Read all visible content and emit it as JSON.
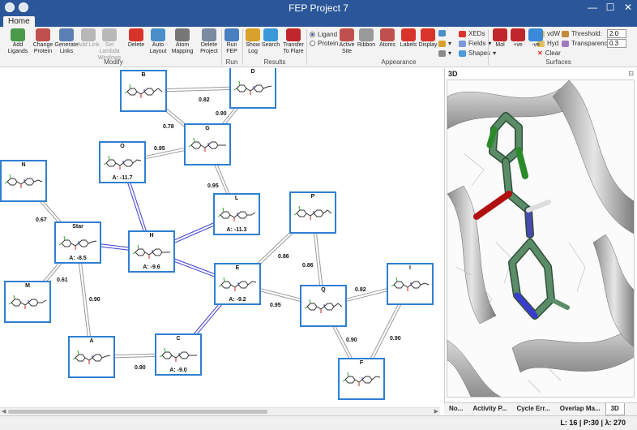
{
  "app": {
    "title": "FEP Project 7",
    "active_tab": "Home",
    "window_controls": [
      "—",
      "☐",
      "✕"
    ]
  },
  "ribbon": {
    "modify": {
      "group_label": "Modify",
      "buttons": [
        {
          "label": "Add Ligands",
          "icon": "add-ligands-icon",
          "color": "#4a9a4a"
        },
        {
          "label": "Change Protein",
          "icon": "change-protein-icon",
          "color": "#c0504d"
        },
        {
          "label": "Generate Links",
          "icon": "generate-links-icon",
          "color": "#5a7fb5"
        },
        {
          "label": "Add Link",
          "icon": "add-link-icon",
          "color": "#b8b8b8"
        },
        {
          "label": "Set Lambda Windows",
          "icon": "lambda-icon",
          "color": "#b8b8b8"
        },
        {
          "label": "Delete",
          "icon": "delete-icon",
          "color": "#d9342b"
        },
        {
          "label": "Auto Layout",
          "icon": "auto-layout-icon",
          "color": "#4a8fc9"
        },
        {
          "label": "Atom Mapping",
          "icon": "atom-mapping-icon",
          "color": "#777777"
        },
        {
          "label": "Delete Project",
          "icon": "delete-project-icon",
          "color": "#7a8aa0"
        }
      ]
    },
    "run": {
      "group_label": "Run",
      "buttons": [
        {
          "label": "Run FEP",
          "icon": "calculator-icon",
          "color": "#4a7fc1"
        }
      ]
    },
    "results": {
      "group_label": "Results",
      "buttons": [
        {
          "label": "Show Log",
          "icon": "log-icon",
          "color": "#d9a02b"
        },
        {
          "label": "Search",
          "icon": "search-icon",
          "color": "#3a9ad9"
        },
        {
          "label": "Transfer To Flare",
          "icon": "flare-icon",
          "color": "#c0272d"
        }
      ]
    },
    "view": {
      "radios": [
        {
          "label": "Ligand",
          "selected": true
        },
        {
          "label": "Protein",
          "selected": false
        }
      ],
      "group_label": "Appearance",
      "buttons": [
        {
          "label": "Active Site",
          "icon": "active-site-icon",
          "color": "#c0504d"
        },
        {
          "label": "Ribbon",
          "icon": "ribbon-icon",
          "color": "#9a9a9a"
        },
        {
          "label": "Atoms",
          "icon": "atoms-icon",
          "color": "#c0504d"
        },
        {
          "label": "Labels",
          "icon": "labels-icon",
          "color": "#d9342b"
        },
        {
          "label": "Display",
          "icon": "display-icon",
          "color": "#d9342b"
        }
      ],
      "small": [
        {
          "label": "XEDs"
        },
        {
          "label": "Fields"
        },
        {
          "label": "Shapes"
        }
      ]
    },
    "surfaces": {
      "group_label": "Surfaces",
      "buttons": [
        {
          "label": "Mol",
          "icon": "mol-surface-icon",
          "color": "#c0272d"
        },
        {
          "label": "+ve",
          "icon": "positive-icon",
          "color": "#c0272d"
        },
        {
          "label": "-ve",
          "icon": "negative-icon",
          "color": "#3a8ad9"
        }
      ],
      "small": [
        {
          "label": "vdW"
        },
        {
          "label": "Hyd"
        },
        {
          "label": "Clear"
        }
      ],
      "threshold_label": "Threshold:",
      "threshold_value": "2.0",
      "transparency_label": "Transparency:",
      "transparency_value": "0.3"
    }
  },
  "graph": {
    "nodes": [
      {
        "id": "B",
        "name": "B",
        "affinity": ""
      },
      {
        "id": "D",
        "name": "D",
        "affinity": ""
      },
      {
        "id": "G",
        "name": "G",
        "affinity": ""
      },
      {
        "id": "O",
        "name": "O",
        "affinity": "A: -11.7"
      },
      {
        "id": "N",
        "name": "N",
        "affinity": ""
      },
      {
        "id": "L",
        "name": "L",
        "affinity": "A: -11.3"
      },
      {
        "id": "P",
        "name": "P",
        "affinity": ""
      },
      {
        "id": "Star",
        "name": "Star",
        "affinity": "A: -8.5"
      },
      {
        "id": "H",
        "name": "H",
        "affinity": "A: -9.6"
      },
      {
        "id": "E",
        "name": "E",
        "affinity": "A: -9.2"
      },
      {
        "id": "I",
        "name": "I",
        "affinity": ""
      },
      {
        "id": "M",
        "name": "M",
        "affinity": ""
      },
      {
        "id": "Q",
        "name": "Q",
        "affinity": ""
      },
      {
        "id": "A",
        "name": "A",
        "affinity": ""
      },
      {
        "id": "C",
        "name": "C",
        "affinity": "A: -9.0"
      },
      {
        "id": "F",
        "name": "F",
        "affinity": ""
      }
    ],
    "edges": [
      {
        "from": "B",
        "to": "D",
        "label": "0.82",
        "color": "#9a9a9a"
      },
      {
        "from": "D",
        "to": "G",
        "label": "0.90",
        "color": "#9a9a9a"
      },
      {
        "from": "B",
        "to": "G",
        "label": "0.78",
        "color": "#9a9a9a"
      },
      {
        "from": "O",
        "to": "G",
        "label": "0.95",
        "color": "#9a9a9a"
      },
      {
        "from": "G",
        "to": "L",
        "label": "0.95",
        "color": "#9a9a9a"
      },
      {
        "from": "N",
        "to": "Star",
        "label": "0.67",
        "color": "#9a9a9a"
      },
      {
        "from": "Star",
        "to": "M",
        "label": "0.61",
        "color": "#9a9a9a"
      },
      {
        "from": "Star",
        "to": "A",
        "label": "0.90",
        "color": "#9a9a9a"
      },
      {
        "from": "A",
        "to": "C",
        "label": "0.90",
        "color": "#9a9a9a"
      },
      {
        "from": "P",
        "to": "E",
        "label": "0.86",
        "color": "#9a9a9a"
      },
      {
        "from": "P",
        "to": "Q",
        "label": "0.86",
        "color": "#9a9a9a"
      },
      {
        "from": "E",
        "to": "Q",
        "label": "0.95",
        "color": "#9a9a9a"
      },
      {
        "from": "Q",
        "to": "I",
        "label": "0.82",
        "color": "#9a9a9a"
      },
      {
        "from": "Q",
        "to": "F",
        "label": "0.90",
        "color": "#9a9a9a"
      },
      {
        "from": "I",
        "to": "F",
        "label": "0.90",
        "color": "#9a9a9a"
      },
      {
        "from": "O",
        "to": "H",
        "label": "",
        "color": "#3b3bcf"
      },
      {
        "from": "Star",
        "to": "H",
        "label": "",
        "color": "#3b3bcf"
      },
      {
        "from": "H",
        "to": "L",
        "label": "",
        "color": "#3b3bcf"
      },
      {
        "from": "H",
        "to": "E",
        "label": "",
        "color": "#3b3bcf"
      },
      {
        "from": "E",
        "to": "C",
        "label": "",
        "color": "#3b3bcf"
      }
    ]
  },
  "viewer": {
    "title": "3D",
    "pin": "⊡"
  },
  "bottom_tabs": [
    {
      "label": "No...",
      "active": false
    },
    {
      "label": "Activity P...",
      "active": false
    },
    {
      "label": "Cycle Err...",
      "active": false
    },
    {
      "label": "Overlap Ma...",
      "active": false
    },
    {
      "label": "3D",
      "active": true
    }
  ],
  "status": {
    "text": "L: 16 | P:30 | λ: 270"
  },
  "colors": {
    "accent": "#2b579a",
    "node_border": "#2f7fd2",
    "chlorine": "#3cc83c",
    "oxygen": "#e02020",
    "nitrogen": "#3b3bcf",
    "carbon": "#4e7d5e"
  }
}
